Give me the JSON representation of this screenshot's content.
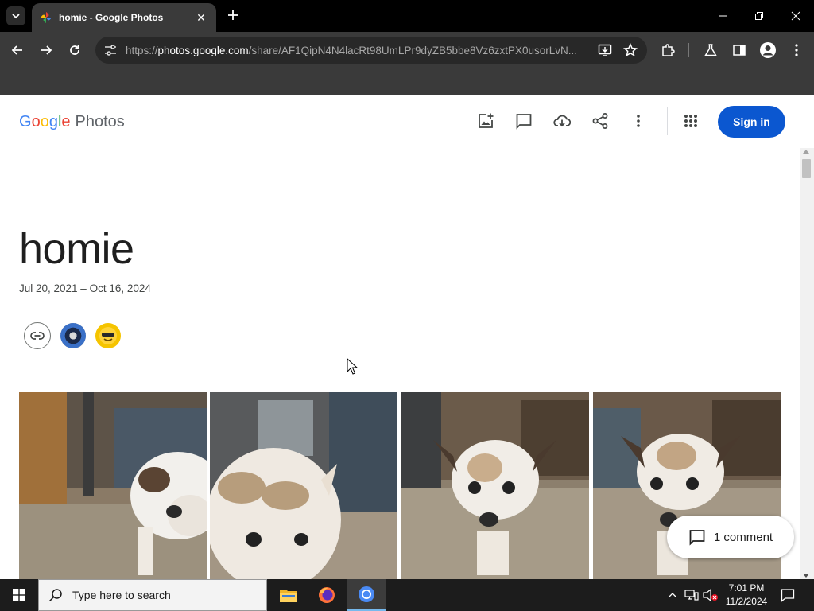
{
  "browser": {
    "tab": {
      "title": "homie - Google Photos",
      "close": "✕"
    },
    "new_tab": "+",
    "url": {
      "scheme": "https://",
      "host": "photos.google.com",
      "path": "/share/AF1QipN4N4lacRt98UmLPr9dyZB5bbe8Vz6zxtPX0usorLvN..."
    }
  },
  "header": {
    "logo": {
      "g1": "G",
      "g2": "o",
      "g3": "o",
      "g4": "g",
      "g5": "l",
      "g6": "e",
      "product": "Photos"
    },
    "signin_label": "Sign in"
  },
  "album": {
    "title": "homie",
    "dates": "Jul 20, 2021 – Oct 16, 2024"
  },
  "comment_chip": {
    "label": "1 comment"
  },
  "taskbar": {
    "search_placeholder": "Type here to search",
    "time": "7:01 PM",
    "date": "11/2/2024"
  },
  "colors": {
    "accent": "#0b57d0",
    "chrome_dark": "#3a3a3a",
    "taskbar": "#1c1c1c"
  }
}
